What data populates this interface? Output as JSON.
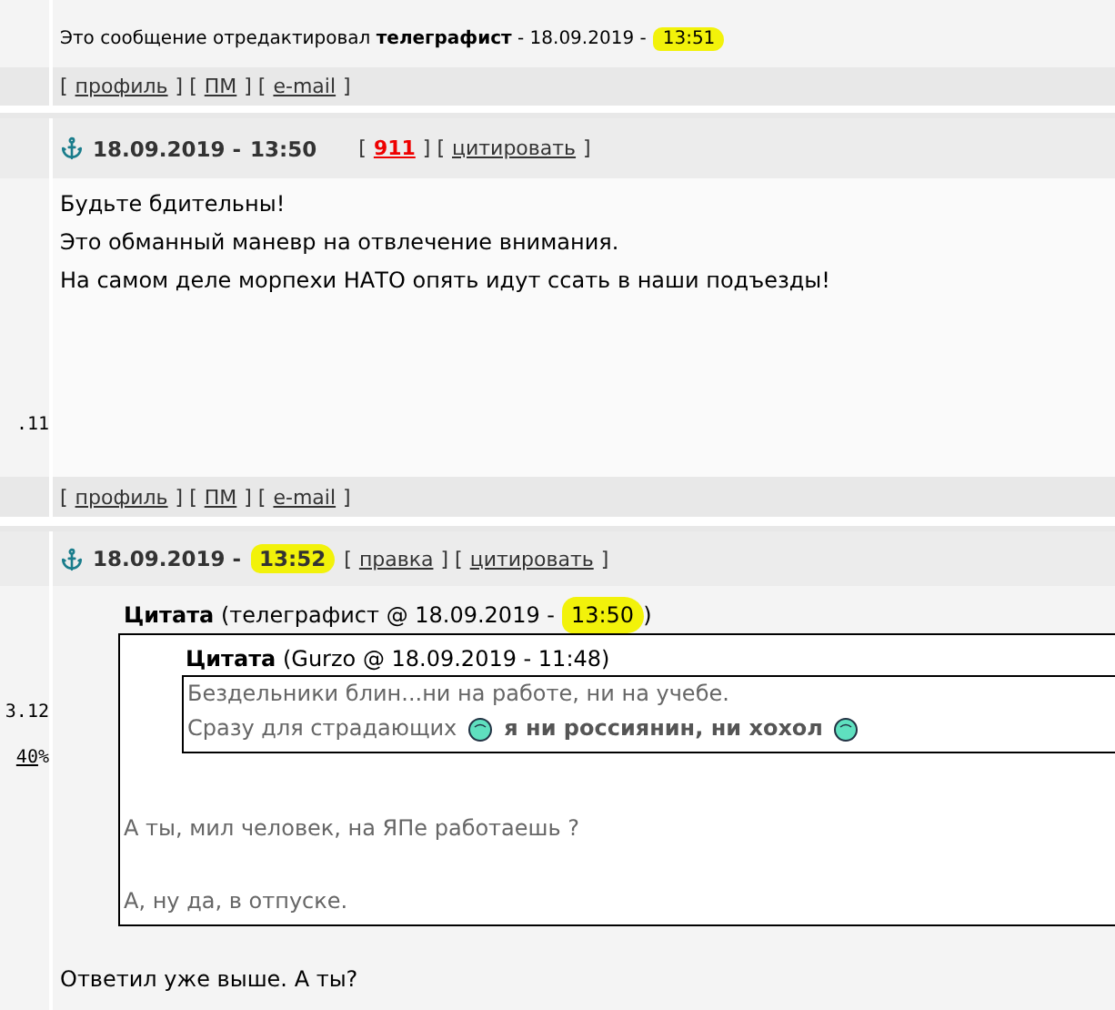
{
  "previous_post": {
    "edit_note": {
      "text": "Это сообщение отредактировал **телеграфист** - 18.09.2019 -",
      "time": "13:51",
      "time_highlighted": true
    },
    "links": [
      {
        "kind": "text",
        "text": "["
      },
      {
        "kind": "link",
        "text": "профиль"
      },
      {
        "kind": "text",
        "text": "] ["
      },
      {
        "kind": "link",
        "text": "ПМ"
      },
      {
        "kind": "text",
        "text": "] ["
      },
      {
        "kind": "link",
        "text": "e-mail"
      },
      {
        "kind": "text",
        "text": "]"
      }
    ]
  },
  "posts": [
    {
      "date_text": "18.09.2019 -",
      "time": "13:50",
      "time_highlighted": false,
      "actions": [
        {
          "kind": "text",
          "text": "["
        },
        {
          "kind": "alert",
          "text": "911"
        },
        {
          "kind": "text",
          "text": "] ["
        },
        {
          "kind": "link",
          "text": "цитировать"
        },
        {
          "kind": "text",
          "text": "]"
        }
      ],
      "side": [
        {
          "kind": "text",
          "text": ".11"
        }
      ],
      "body": [
        "Будьте бдительны!",
        "Это обманный маневр на отвлечение внимания.",
        "На самом деле морпехи НАТО опять идут ссать в наши подъезды!"
      ],
      "links": [
        {
          "kind": "text",
          "text": "["
        },
        {
          "kind": "link",
          "text": "профиль"
        },
        {
          "kind": "text",
          "text": "] ["
        },
        {
          "kind": "link",
          "text": "ПМ"
        },
        {
          "kind": "text",
          "text": "] ["
        },
        {
          "kind": "link",
          "text": "e-mail"
        },
        {
          "kind": "text",
          "text": "]"
        }
      ]
    },
    {
      "date_text": "18.09.2019 -",
      "time": "13:52",
      "time_highlighted": true,
      "actions": [
        {
          "kind": "text",
          "text": "["
        },
        {
          "kind": "link",
          "text": "правка"
        },
        {
          "kind": "text",
          "text": "] ["
        },
        {
          "kind": "link",
          "text": "цитировать"
        },
        {
          "kind": "text",
          "text": "]"
        }
      ],
      "side": [
        {
          "kind": "text",
          "text": "3.12"
        },
        {
          "kind": "link",
          "text": "40",
          "suffix": "%"
        }
      ],
      "quote": {
        "title": "**Цитата** (телеграфист @ 18.09.2019 -",
        "time": "13:50",
        "time_highlighted": true,
        "close": ")",
        "nested": {
          "title": "**Цитата** (Gurzo @ 18.09.2019 - 11:48)",
          "lines": [
            [
              {
                "kind": "text",
                "text": "Бездельники блин...ни на работе, ни на учебе."
              }
            ],
            [
              {
                "kind": "text",
                "text": "Сразу для страдающих"
              },
              {
                "kind": "smiley"
              },
              {
                "kind": "bold",
                "text": "я ни россиянин, ни хохол"
              },
              {
                "kind": "smiley"
              }
            ]
          ]
        },
        "lines": [
          "А ты, мил человек, на ЯПе работаешь ?",
          "А, ну да, в отпуске."
        ]
      },
      "reply": "Ответил уже выше. А ты?"
    }
  ]
}
